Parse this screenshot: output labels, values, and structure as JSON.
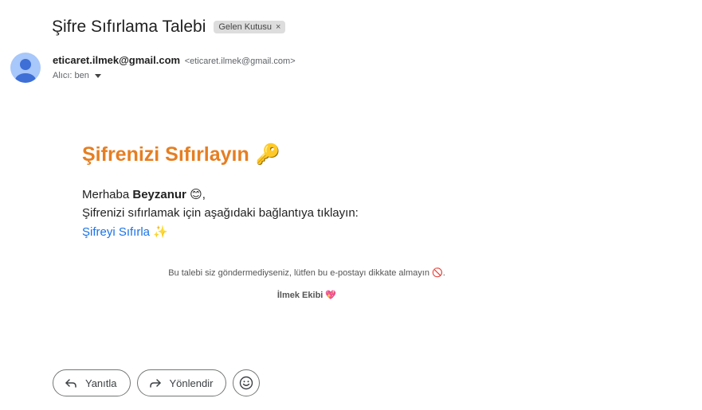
{
  "header": {
    "subject": "Şifre Sıfırlama Talebi",
    "label": "Gelen Kutusu",
    "label_remove": "×"
  },
  "sender": {
    "name": "eticaret.ilmek@gmail.com",
    "email": "<eticaret.ilmek@gmail.com>",
    "recipient": "Alıcı: ben",
    "avatar_color": "#a8c7fa"
  },
  "body": {
    "heading": "Şifrenizi Sıfırlayın",
    "heading_emoji": "🔑",
    "greeting_prefix": "Merhaba ",
    "greeting_name": "Beyzanur",
    "greeting_suffix": " 😊,",
    "instruction": "Şifrenizi sıfırlamak için aşağıdaki bağlantıya tıklayın:",
    "link_text": "Şifreyi Sıfırla",
    "link_emoji": "✨",
    "heading_color": "#e67e22",
    "link_color": "#1a73e8"
  },
  "footer": {
    "note": "Bu talebi siz göndermediyseniz, lütfen bu e-postayı dikkate almayın",
    "note_emoji": "🚫",
    "note_end": ".",
    "team": "İlmek Ekibi",
    "team_emoji": "💖"
  },
  "actions": {
    "reply_label": "Yanıtla",
    "forward_label": "Yönlendir"
  }
}
